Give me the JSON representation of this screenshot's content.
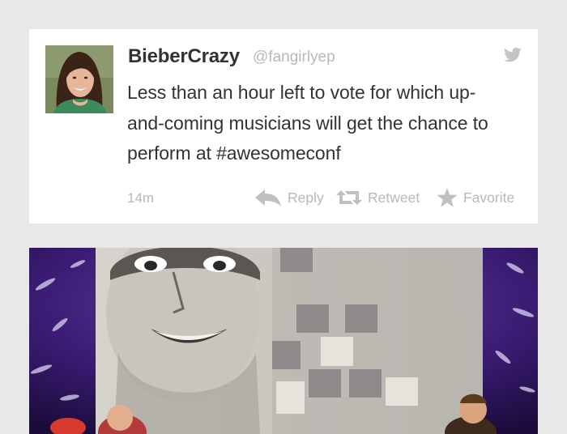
{
  "tweet": {
    "display_name": "BieberCrazy",
    "handle": "@fangirlyep",
    "text": "Less than an hour left to vote for which up-and-coming musicians will get the chance to perform at #awesomeconf",
    "time": "14m",
    "actions": {
      "reply": "Reply",
      "retweet": "Retweet",
      "favorite": "Favorite"
    },
    "icons": {
      "service": "twitter-bird-icon",
      "reply": "reply-arrow-icon",
      "retweet": "retweet-icon",
      "favorite": "star-icon"
    }
  },
  "colors": {
    "background": "#e8e8e8",
    "card": "#ffffff",
    "text": "#333333",
    "muted": "#b8b8b8",
    "stage_purple": "#3b1c74"
  }
}
